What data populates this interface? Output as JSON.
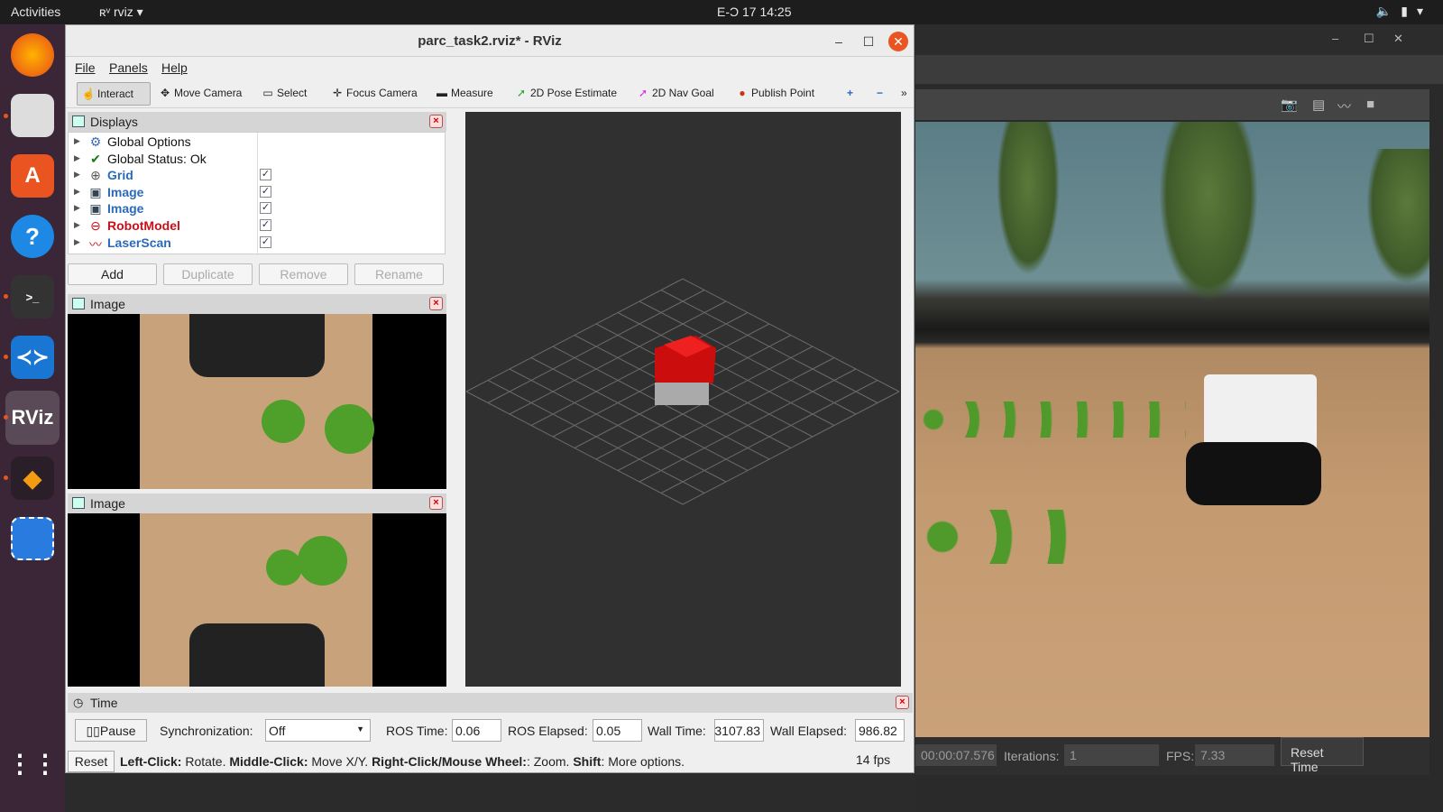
{
  "topbar": {
    "activities": "Activities",
    "app_name": "rviz",
    "datetime": "E-Ɔ 17  14:25"
  },
  "rviz": {
    "title": "parc_task2.rviz* - RViz",
    "menu": {
      "file": "File",
      "panels": "Panels",
      "help": "Help"
    },
    "tools": {
      "interact": "Interact",
      "move_camera": "Move Camera",
      "select": "Select",
      "focus_camera": "Focus Camera",
      "measure": "Measure",
      "pose_estimate": "2D Pose Estimate",
      "nav_goal": "2D Nav Goal",
      "publish_point": "Publish Point"
    },
    "displays": {
      "title": "Displays",
      "items": [
        {
          "label": "Global Options",
          "icon": "gear-icon",
          "color": "#111111",
          "checkbox": false
        },
        {
          "label": "Global Status: Ok",
          "icon": "check-icon",
          "color": "#111111",
          "checkbox": false
        },
        {
          "label": "Grid",
          "icon": "grid-icon",
          "color": "#2a6ab8",
          "checkbox": true
        },
        {
          "label": "Image",
          "icon": "image-icon",
          "color": "#2a6ab8",
          "checkbox": true
        },
        {
          "label": "Image",
          "icon": "image-icon",
          "color": "#2a6ab8",
          "checkbox": true
        },
        {
          "label": "RobotModel",
          "icon": "robot-icon",
          "color": "#c8101a",
          "checkbox": true
        },
        {
          "label": "LaserScan",
          "icon": "laser-icon",
          "color": "#2a6ab8",
          "checkbox": true
        }
      ],
      "buttons": {
        "add": "Add",
        "duplicate": "Duplicate",
        "remove": "Remove",
        "rename": "Rename"
      }
    },
    "image_panel_1": {
      "title": "Image"
    },
    "image_panel_2": {
      "title": "Image"
    },
    "time": {
      "title": "Time",
      "pause": "Pause",
      "sync_label": "Synchronization:",
      "sync_value": "Off",
      "ros_time_label": "ROS Time:",
      "ros_time": "0.06",
      "ros_elapsed_label": "ROS Elapsed:",
      "ros_elapsed": "0.05",
      "wall_time_label": "Wall Time:",
      "wall_time": "3107.83",
      "wall_elapsed_label": "Wall Elapsed:",
      "wall_elapsed": "986.82"
    },
    "status": {
      "reset": "Reset",
      "left_click": "Left-Click:",
      "left_click_text": " Rotate. ",
      "middle_click": "Middle-Click:",
      "middle_click_text": " Move X/Y. ",
      "right_click": "Right-Click/Mouse Wheel:",
      "right_click_text": ": Zoom. ",
      "shift": "Shift",
      "shift_text": ": More options.",
      "fps": "14 fps"
    }
  },
  "gazebo": {
    "sim_time": "00:00:07.576",
    "iterations_label": "Iterations:",
    "iterations": "1",
    "fps_label": "FPS:",
    "fps": "7.33",
    "reset_time": "Reset Time"
  },
  "colors": {
    "accent": "#e95420",
    "robot_red": "#d01010"
  }
}
